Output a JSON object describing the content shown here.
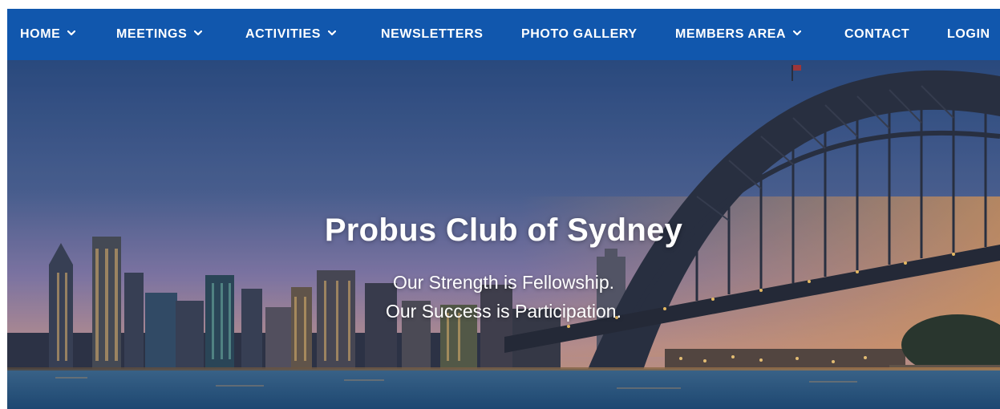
{
  "nav": {
    "items": [
      {
        "label": "HOME",
        "has_dropdown": true
      },
      {
        "label": "MEETINGS",
        "has_dropdown": true
      },
      {
        "label": "ACTIVITIES",
        "has_dropdown": true
      },
      {
        "label": "NEWSLETTERS",
        "has_dropdown": false
      },
      {
        "label": "PHOTO GALLERY",
        "has_dropdown": false
      },
      {
        "label": "MEMBERS AREA",
        "has_dropdown": true
      },
      {
        "label": "CONTACT",
        "has_dropdown": false
      },
      {
        "label": "LOGIN",
        "has_dropdown": false
      }
    ],
    "background_color": "#1157ad",
    "icon": "chevron-down-icon"
  },
  "hero": {
    "title": "Probus Club of Sydney",
    "tagline_1": "Our Strength is Fellowship.",
    "tagline_2": "Our Success is Participation.",
    "image_subject": "Sydney Harbour Bridge and city skyline at dusk"
  }
}
